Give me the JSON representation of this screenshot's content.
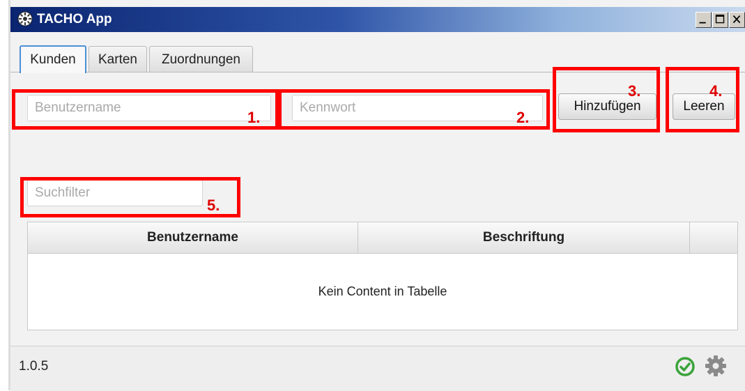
{
  "window": {
    "title": "TACHO App",
    "minimize_glyph": "_",
    "maximize_glyph": "□",
    "close_glyph": "X"
  },
  "tabs": [
    {
      "label": "Kunden",
      "active": true
    },
    {
      "label": "Karten",
      "active": false
    },
    {
      "label": "Zuordnungen",
      "active": false
    }
  ],
  "form": {
    "username_placeholder": "Benutzername",
    "username_value": "",
    "password_placeholder": "Kennwort",
    "password_value": "",
    "add_button": "Hinzufügen",
    "clear_button": "Leeren",
    "search_placeholder": "Suchfilter",
    "search_value": ""
  },
  "annotations": [
    "1.",
    "2.",
    "3.",
    "4.",
    "5."
  ],
  "table": {
    "columns": [
      "Benutzername",
      "Beschriftung",
      ""
    ],
    "rows": [],
    "empty_message": "Kein Content in Tabelle"
  },
  "statusbar": {
    "version": "1.0.5",
    "icons": [
      "check-circle-icon",
      "gear-icon"
    ]
  },
  "colors": {
    "annotation_red": "#ff0000",
    "status_ok_green": "#3aa33a",
    "titlebar_start": "#0a2470",
    "titlebar_end": "#c9d9ee"
  }
}
